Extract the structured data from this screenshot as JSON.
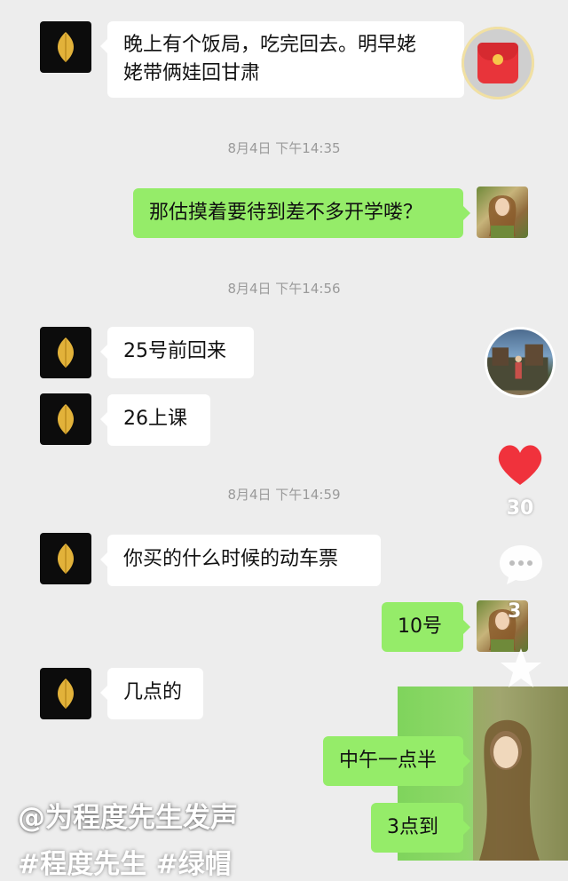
{
  "messages": [
    {
      "side": "left",
      "text_line1": "晚上有个饭局，吃完回去。明早姥",
      "text_line2": "姥带俩娃回甘肃"
    },
    {
      "side": "right",
      "text": "那估摸着要待到差不多开学喽？"
    },
    {
      "side": "left",
      "text": "25号前回来"
    },
    {
      "side": "left",
      "text": "26上课"
    },
    {
      "side": "left",
      "text": "你买的什么时候的动车票"
    },
    {
      "side": "right",
      "text": "10号"
    },
    {
      "side": "left",
      "text": "几点的"
    },
    {
      "side": "right",
      "text": "中午一点半"
    },
    {
      "side": "right",
      "text": "3点到"
    }
  ],
  "timestamps": [
    "8月4日 下午14:35",
    "8月4日 下午14:56",
    "8月4日 下午14:59"
  ],
  "video_ui": {
    "like_count": "30",
    "comment_count": "3",
    "caption": "@为程度先生发声",
    "hashtags": "#程度先生 #绿帽"
  },
  "colors": {
    "chat_background": "#ededed",
    "my_bubble": "#95ec69",
    "their_bubble": "#ffffff",
    "like_heart": "#f0323c"
  },
  "icons": [
    "leaf-avatar-icon",
    "red-packet-icon",
    "heart-icon",
    "comment-icon",
    "star-icon"
  ]
}
